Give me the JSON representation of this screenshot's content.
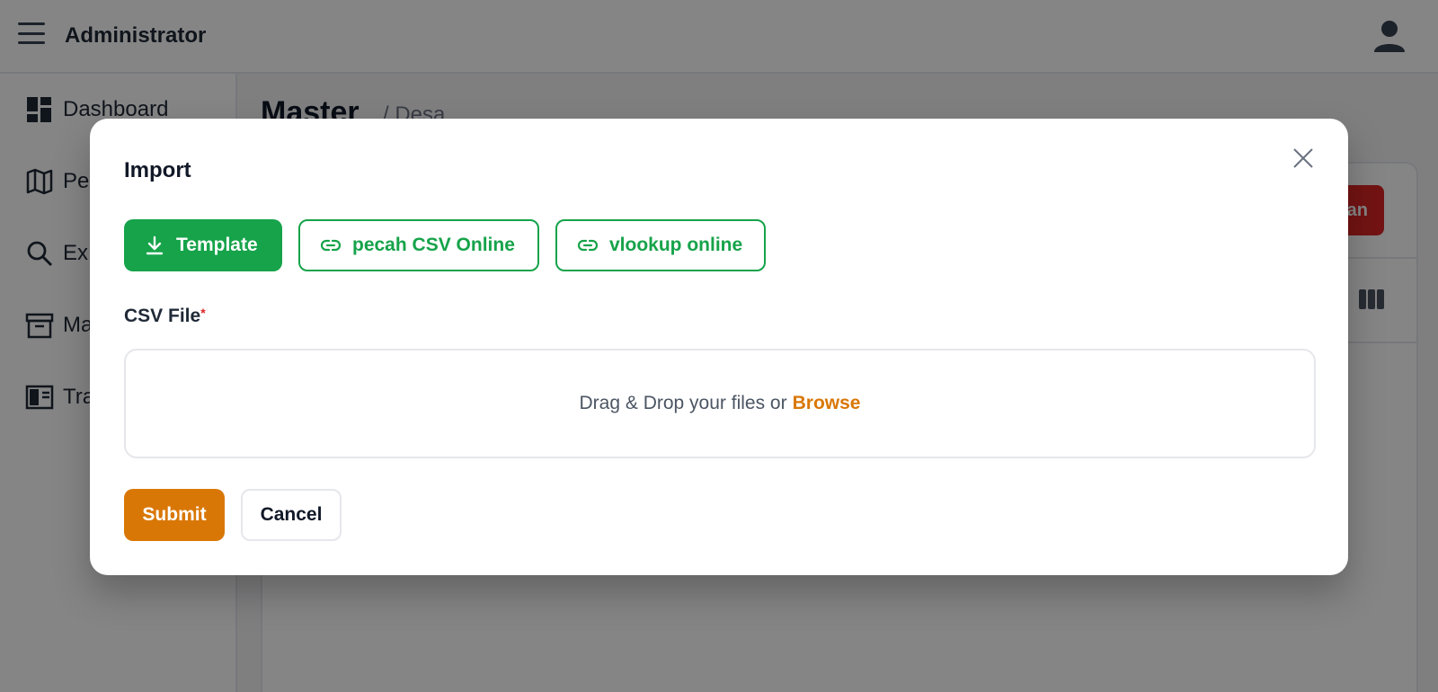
{
  "app": {
    "title": "Administrator"
  },
  "sidebar": {
    "items": [
      {
        "label": "Dashboard",
        "icon": "grid-icon"
      },
      {
        "label": "Pe",
        "icon": "map-icon"
      },
      {
        "label": "Ex",
        "icon": "search-icon"
      },
      {
        "label": "Ma",
        "icon": "archive-icon"
      },
      {
        "label": "Tra",
        "icon": "layout-icon"
      }
    ]
  },
  "page": {
    "title": "Master",
    "breadcrumb": "/ Desa",
    "partial_button_label": "an"
  },
  "modal": {
    "title": "Import",
    "buttons": {
      "template": "Template",
      "pecah": "pecah CSV Online",
      "vlookup": "vlookup online"
    },
    "field_label": "CSV File",
    "required_mark": "*",
    "dropzone_text": "Drag & Drop your files or",
    "browse_label": "Browse",
    "submit_label": "Submit",
    "cancel_label": "Cancel"
  },
  "colors": {
    "primary_green": "#16a34a",
    "accent_orange": "#d97706",
    "danger_red": "#dc2626"
  }
}
